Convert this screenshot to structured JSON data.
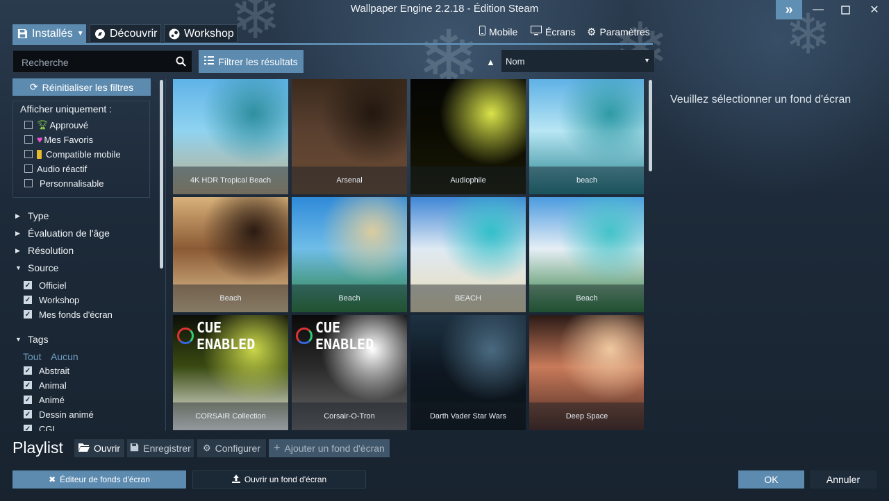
{
  "window": {
    "title": "Wallpaper Engine 2.2.18 - Édition Steam",
    "controls": [
      "chevrons-right-icon",
      "minimize-icon",
      "maximize-icon",
      "close-icon"
    ]
  },
  "tabs": [
    {
      "label": "Installés",
      "icon": "save-icon",
      "active": true,
      "has_dropdown": true
    },
    {
      "label": "Découvrir",
      "icon": "compass-icon",
      "active": false
    },
    {
      "label": "Workshop",
      "icon": "steam-icon",
      "active": false
    }
  ],
  "top_links": [
    {
      "label": "Mobile",
      "icon": "phone-icon"
    },
    {
      "label": "Écrans",
      "icon": "monitor-icon"
    },
    {
      "label": "Paramètres",
      "icon": "gear-icon"
    }
  ],
  "search": {
    "placeholder": "Recherche",
    "value": ""
  },
  "filter_button": "Filtrer les résultats",
  "sort": {
    "selected": "Nom",
    "direction": "ascending"
  },
  "filters": {
    "reset_label": "Réinitialiser les filtres",
    "show_only_label": "Afficher uniquement :",
    "show_only": [
      {
        "label": "Approuvé",
        "icon": "trophy-icon",
        "checked": false
      },
      {
        "label": "Mes Favoris",
        "icon": "heart-icon",
        "checked": false
      },
      {
        "label": "Compatible mobile",
        "icon": "phone-icon",
        "checked": false
      },
      {
        "label": "Audio réactif",
        "checked": false
      },
      {
        "label": "Personnalisable",
        "checked": false
      }
    ],
    "sections": [
      {
        "label": "Type",
        "expanded": false
      },
      {
        "label": "Évaluation de l'âge",
        "expanded": false
      },
      {
        "label": "Résolution",
        "expanded": false
      },
      {
        "label": "Source",
        "expanded": true
      }
    ],
    "source_items": [
      {
        "label": "Officiel",
        "checked": true
      },
      {
        "label": "Workshop",
        "checked": true
      },
      {
        "label": "Mes fonds d'écran",
        "checked": true
      }
    ],
    "tags_label": "Tags",
    "tags_all": "Tout",
    "tags_none": "Aucun",
    "tags": [
      {
        "label": "Abstrait",
        "checked": true
      },
      {
        "label": "Animal",
        "checked": true
      },
      {
        "label": "Animé",
        "checked": true
      },
      {
        "label": "Dessin animé",
        "checked": true
      },
      {
        "label": "CGI",
        "checked": true
      }
    ]
  },
  "wallpapers": [
    {
      "title": "4K HDR Tropical Beach",
      "palette": [
        "#5fb3e8",
        "#8fd3f0",
        "#2f8fa0",
        "#bfae8a"
      ]
    },
    {
      "title": "Arsenal",
      "palette": [
        "#3a2a1c",
        "#5a4030",
        "#22180f",
        "#6b4c34"
      ]
    },
    {
      "title": "Audiophile",
      "palette": [
        "#050505",
        "#0b0b02",
        "#d9e34a",
        "#1a1a05"
      ]
    },
    {
      "title": "beach",
      "palette": [
        "#5fb1e6",
        "#b8e6f4",
        "#2f9aa5",
        "#1f7f8a"
      ]
    },
    {
      "title": "Beach",
      "palette": [
        "#d8b17a",
        "#8a5a34",
        "#2b1b12",
        "#e6c89a"
      ]
    },
    {
      "title": "Beach",
      "palette": [
        "#2f8ad8",
        "#6fbde8",
        "#dbcca0",
        "#2b7f3a"
      ]
    },
    {
      "title": "BEACH",
      "palette": [
        "#3f86d6",
        "#dfe9f3",
        "#33c0c9",
        "#e9ddb6"
      ]
    },
    {
      "title": "Beach",
      "palette": [
        "#4a9be0",
        "#e6eef5",
        "#44c3c8",
        "#2a7a3a"
      ]
    },
    {
      "title": "CORSAIR Collection",
      "palette": [
        "#0c0f08",
        "#3a4a12",
        "#c9d64a",
        "#ffffff"
      ],
      "badge": "CUE ENABLED"
    },
    {
      "title": "Corsair-O-Tron",
      "palette": [
        "#0a0a0a",
        "#2a2a2a",
        "#ffffff",
        "#6a6a6a"
      ],
      "badge": "CUE ENABLED"
    },
    {
      "title": "Darth Vader Star Wars",
      "palette": [
        "#1e3242",
        "#0e1822",
        "#4a6a80",
        "#0a1016"
      ]
    },
    {
      "title": "Deep Space",
      "palette": [
        "#2a1a16",
        "#c87a5a",
        "#f0c8a0",
        "#4a2a22"
      ]
    }
  ],
  "detail_placeholder": "Veuillez sélectionner un fond d'écran",
  "playlist": {
    "label": "Playlist",
    "buttons": [
      {
        "label": "Ouvrir",
        "icon": "folder-open-icon"
      },
      {
        "label": "Enregistrer",
        "icon": "save-icon"
      },
      {
        "label": "Configurer",
        "icon": "gears-icon"
      },
      {
        "label": "Ajouter un fond d'écran",
        "icon": "plus-icon"
      }
    ]
  },
  "footer": {
    "editor_button": "Éditeur de fonds d'écran",
    "open_button": "Ouvrir un fond d'écran",
    "ok_button": "OK",
    "cancel_button": "Annuler"
  },
  "colors": {
    "accent": "#5d8bb0",
    "background": "#1d2a39"
  }
}
